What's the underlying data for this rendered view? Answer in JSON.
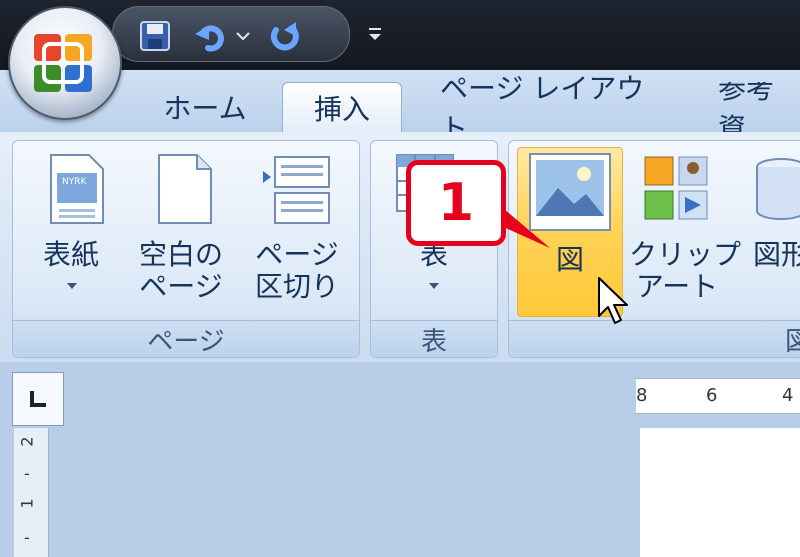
{
  "tabs": [
    {
      "label": "ホーム"
    },
    {
      "label": "挿入"
    },
    {
      "label": "ページ レイアウト"
    },
    {
      "label": "参考資"
    }
  ],
  "groups": {
    "page": {
      "label": "ページ",
      "cover": {
        "label": "表紙",
        "thumb_text": "NYRK"
      },
      "blank": {
        "label_1": "空白の",
        "label_2": "ページ"
      },
      "break": {
        "label_1": "ページ",
        "label_2": "区切り"
      }
    },
    "table": {
      "label": "表",
      "button_label": "表"
    },
    "illustrations": {
      "picture": {
        "label": "図"
      },
      "clipart": {
        "label_1": "クリップ",
        "label_2": "アート"
      },
      "shapes": {
        "label": "図形"
      },
      "group_label": "図"
    }
  },
  "annotation": {
    "number": "1"
  },
  "ruler": {
    "ticks": [
      "8",
      "6",
      "4"
    ],
    "vertical_ticks": [
      "2",
      "-",
      "1",
      "-"
    ]
  },
  "colors": {
    "accent_red": "#e6001c",
    "ribbon_blue": "#c3d6ed",
    "highlight": "#ffd45a"
  }
}
